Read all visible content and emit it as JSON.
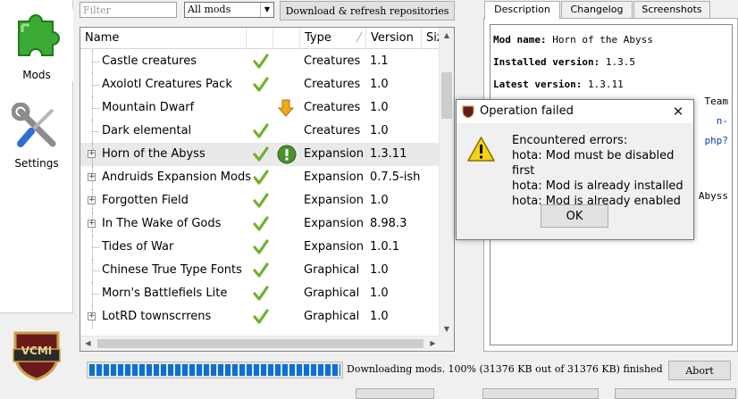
{
  "sidebar": {
    "items": [
      {
        "label": "Mods",
        "icon": "puzzle-piece-icon"
      },
      {
        "label": "Settings",
        "icon": "wrench-screwdriver-icon"
      }
    ],
    "logo_text": "VCMI"
  },
  "toolbar": {
    "filter_placeholder": "Filter",
    "filter_value": "",
    "type_selected": "All mods",
    "refresh_label": "Download & refresh repositories"
  },
  "mod_list": {
    "columns": [
      "Name",
      "",
      "",
      "Type",
      "Version",
      "Siz"
    ],
    "rows": [
      {
        "name": "Castle creatures",
        "enabled": true,
        "status": "",
        "type": "Creatures",
        "version": "1.1",
        "expandable": false
      },
      {
        "name": "Axolotl Creatures Pack",
        "enabled": true,
        "status": "",
        "type": "Creatures",
        "version": "1.0",
        "expandable": false
      },
      {
        "name": "Mountain Dwarf",
        "enabled": false,
        "status": "update",
        "type": "Creatures",
        "version": "1.0",
        "expandable": false
      },
      {
        "name": "Dark elemental",
        "enabled": true,
        "status": "",
        "type": "Creatures",
        "version": "1.0",
        "expandable": false
      },
      {
        "name": "Horn of the Abyss",
        "enabled": true,
        "status": "warning",
        "type": "Expansion",
        "version": "1.3.11",
        "expandable": true,
        "highlight": true
      },
      {
        "name": "Andruids Expansion Mods",
        "enabled": true,
        "status": "",
        "type": "Expansion",
        "version": "0.7.5-ish",
        "expandable": true
      },
      {
        "name": "Forgotten Field",
        "enabled": true,
        "status": "",
        "type": "Expansion",
        "version": "1.0",
        "expandable": true
      },
      {
        "name": "In The Wake of Gods",
        "enabled": true,
        "status": "",
        "type": "Expansion",
        "version": "8.98.3",
        "expandable": true
      },
      {
        "name": "Tides of War",
        "enabled": true,
        "status": "",
        "type": "Expansion",
        "version": "1.0.1",
        "expandable": false
      },
      {
        "name": "Chinese True Type Fonts",
        "enabled": true,
        "status": "",
        "type": "Graphical",
        "version": "1.0",
        "expandable": false
      },
      {
        "name": "Morn's Battlefiels Lite",
        "enabled": true,
        "status": "",
        "type": "Graphical",
        "version": "1.0",
        "expandable": false
      },
      {
        "name": "LotRD townscrrens",
        "enabled": true,
        "status": "",
        "type": "Graphical",
        "version": "1.0",
        "expandable": true
      }
    ]
  },
  "details": {
    "tabs": [
      "Description",
      "Changelog",
      "Screenshots"
    ],
    "active_tab": "Description",
    "mod_name_label": "Mod name:",
    "mod_name_value": "Horn of the Abyss",
    "installed_label": "Installed version:",
    "installed_value": "1.3.5",
    "latest_label": "Latest version:",
    "latest_value": "1.3.11",
    "fragments": [
      "Team",
      "n-",
      "php?",
      "Abyss"
    ]
  },
  "download": {
    "progress_percent": 100,
    "status_text": "Downloading mods. 100% (31376 KB out of 31376 KB) finished",
    "abort_label": "Abort"
  },
  "dialog": {
    "title": "Operation failed",
    "icon": "warning-icon",
    "message_lines": [
      "Encountered errors:",
      "hota: Mod must be disabled first",
      "hota: Mod is already installed",
      "hota: Mod is already enabled"
    ],
    "ok_label": "OK"
  },
  "colors": {
    "check": "#6fb22e",
    "progress": "#0a6fd6",
    "warning": "#f7d117",
    "update_arrow": "#f0a81c"
  }
}
